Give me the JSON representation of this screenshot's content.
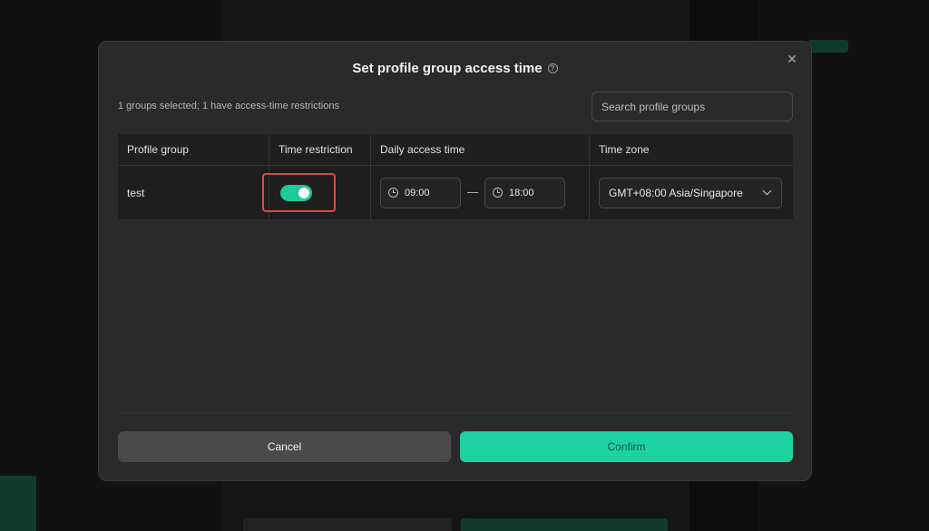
{
  "modal": {
    "title": "Set profile group access time",
    "help_icon": "?",
    "close_icon": "✕",
    "summary": "1 groups selected; 1 have access-time restrictions",
    "search_placeholder": "Search profile groups"
  },
  "table": {
    "headers": [
      "Profile group",
      "Time restriction",
      "Daily access time",
      "Time zone"
    ],
    "rows": [
      {
        "group": "test",
        "restriction_enabled": true,
        "start_time": "09:00",
        "end_time": "18:00",
        "time_zone": "GMT+08:00 Asia/Singapore"
      }
    ]
  },
  "buttons": {
    "cancel": "Cancel",
    "confirm": "Confirm"
  },
  "colors": {
    "accent": "#1dd3a0",
    "highlight": "#e04646",
    "modal_bg": "#2a2a2a"
  }
}
